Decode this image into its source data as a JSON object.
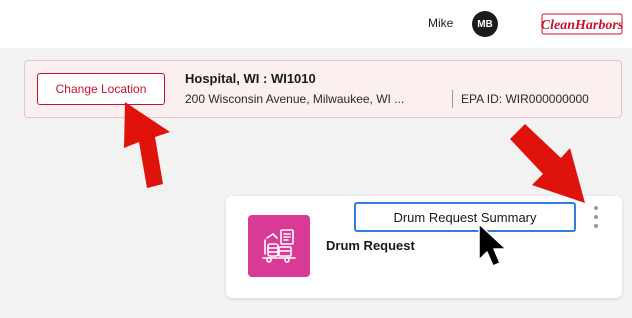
{
  "header": {
    "user_name": "Mike",
    "avatar_initials": "MB",
    "logo_text": "CleanHarbors",
    "logo_color": "#c8102e"
  },
  "location": {
    "change_button_label": "Change Location",
    "name": "Hospital, WI : WI1010",
    "address": "200 Wisconsin Avenue, Milwaukee, WI ...",
    "epa_id": "EPA ID: WIR000000000"
  },
  "card": {
    "title": "Drum Request",
    "summary_button_label": "Drum Request Summary",
    "icon": "drum-request-icon",
    "menu_icon": "kebab-menu-icon",
    "accent_color": "#d93a96"
  },
  "annotations": {
    "arrow_color": "#e0120c",
    "arrows": [
      "red-arrow-icon",
      "red-arrow-icon"
    ],
    "cursor": "mouse-cursor-icon"
  }
}
